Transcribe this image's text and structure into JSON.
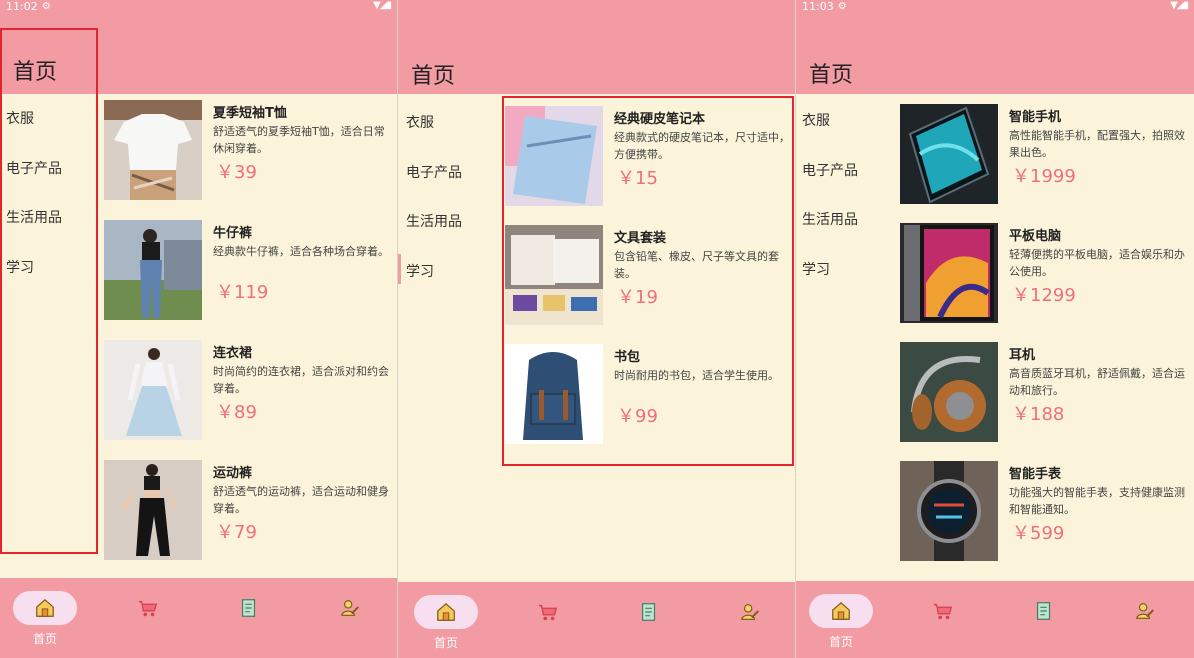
{
  "phones": [
    {
      "time": "11:02",
      "title": "首页",
      "sidebar": [
        "衣服",
        "电子产品",
        "生活用品",
        "学习"
      ],
      "products": [
        {
          "name": "夏季短袖T恤",
          "desc": "舒适透气的夏季短袖T恤，适合日常休闲穿着。",
          "price": "￥39"
        },
        {
          "name": "牛仔裤",
          "desc": "经典款牛仔裤，适合各种场合穿着。",
          "price": "￥119"
        },
        {
          "name": "连衣裙",
          "desc": "时尚简约的连衣裙，适合派对和约会穿着。",
          "price": "￥89"
        },
        {
          "name": "运动裤",
          "desc": "舒适透气的运动裤，适合运动和健身穿着。",
          "price": "￥79"
        }
      ],
      "tab_label": "首页"
    },
    {
      "time": "",
      "title": "首页",
      "sidebar": [
        "衣服",
        "电子产品",
        "生活用品",
        "学习"
      ],
      "products": [
        {
          "name": "经典硬皮笔记本",
          "desc": "经典款式的硬皮笔记本，尺寸适中，方便携带。",
          "price": "￥15"
        },
        {
          "name": "文具套装",
          "desc": "包含铅笔、橡皮、尺子等文具的套装。",
          "price": "￥19"
        },
        {
          "name": "书包",
          "desc": "时尚耐用的书包，适合学生使用。",
          "price": "￥99"
        }
      ],
      "tab_label": "首页"
    },
    {
      "time": "11:03",
      "title": "首页",
      "sidebar": [
        "衣服",
        "电子产品",
        "生活用品",
        "学习"
      ],
      "products": [
        {
          "name": "智能手机",
          "desc": "高性能智能手机，配置强大，拍照效果出色。",
          "price": "￥1999"
        },
        {
          "name": "平板电脑",
          "desc": "轻薄便携的平板电脑，适合娱乐和办公使用。",
          "price": "￥1299"
        },
        {
          "name": "耳机",
          "desc": "高音质蓝牙耳机，舒适佩戴，适合运动和旅行。",
          "price": "￥188"
        },
        {
          "name": "智能手表",
          "desc": "功能强大的智能手表，支持健康监测和智能通知。",
          "price": "￥599"
        }
      ],
      "tab_label": "首页"
    }
  ],
  "icons": [
    "home-icon",
    "cart-icon",
    "orders-icon",
    "profile-icon"
  ],
  "colors": {
    "header": "#f29ba3",
    "background": "#fbf4da",
    "price": "#ef6f7c",
    "highlight": "#e3262d",
    "active_tab": "#f8dff0"
  }
}
